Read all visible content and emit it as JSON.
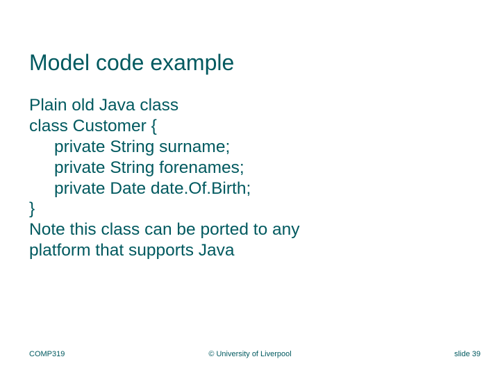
{
  "title": "Model code example",
  "body": {
    "line1": "Plain old Java class",
    "line2": "class Customer {",
    "line3": "private String surname;",
    "line4": "private String forenames;",
    "line5": "private Date date.Of.Birth;",
    "line6": "}",
    "line7": "Note this class can be ported to any",
    "line8": "platform that supports Java"
  },
  "footer": {
    "left": "COMP319",
    "center": "© University of Liverpool",
    "right": "slide  39"
  }
}
